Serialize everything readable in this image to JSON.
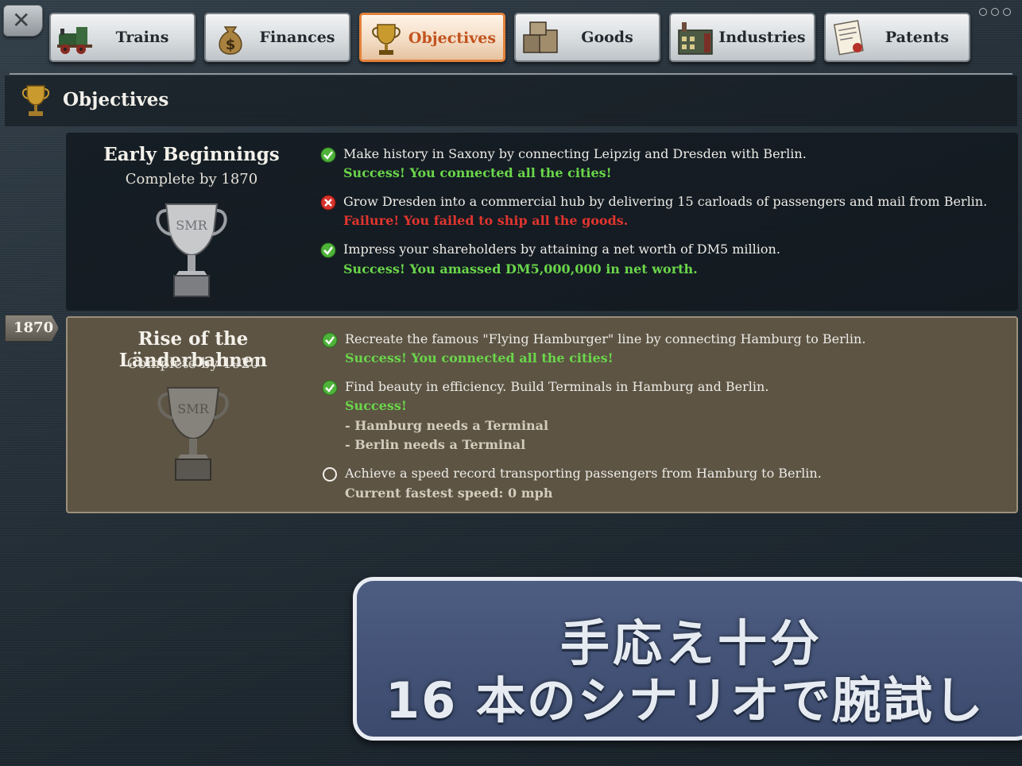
{
  "window": {
    "close_icon": "close-icon"
  },
  "tabs": [
    {
      "label": "Trains",
      "icon": "locomotive-icon",
      "active": false
    },
    {
      "label": "Finances",
      "icon": "money-bag-icon",
      "active": false
    },
    {
      "label": "Objectives",
      "icon": "trophy-icon",
      "active": true
    },
    {
      "label": "Goods",
      "icon": "crates-icon",
      "active": false
    },
    {
      "label": "Industries",
      "icon": "factory-icon",
      "active": false
    },
    {
      "label": "Patents",
      "icon": "patent-document-icon",
      "active": false
    }
  ],
  "header": {
    "title": "Objectives",
    "icon": "trophy-icon"
  },
  "scenarios": [
    {
      "title": "Early Beginnings",
      "deadline": "Complete by 1870",
      "objectives": [
        {
          "status": "success",
          "text": "Make history in Saxony by connecting Leipzig and Dresden with Berlin.",
          "result": "Success! You connected all the cities!"
        },
        {
          "status": "failure",
          "text": "Grow Dresden into a commercial hub by delivering 15 carloads of passengers and mail from Berlin.",
          "result": "Failure! You failed to ship all the goods."
        },
        {
          "status": "success",
          "text": "Impress your shareholders by attaining a net worth of DM5 million.",
          "result": "Success! You amassed DM5,000,000 in net worth."
        }
      ]
    },
    {
      "year_marker": "1870",
      "title": "Rise of the Länderbahnen",
      "deadline": "Complete by 1920",
      "objectives": [
        {
          "status": "success",
          "text": "Recreate the famous \"Flying Hamburger\" line by connecting Hamburg to Berlin.",
          "result": "Success! You connected all the cities!"
        },
        {
          "status": "success",
          "text": "Find beauty in efficiency. Build Terminals in Hamburg and Berlin.",
          "result": "Success!",
          "notes": [
            "- Hamburg needs a Terminal",
            "- Berlin needs a Terminal"
          ]
        },
        {
          "status": "pending",
          "text": "Achieve a speed record transporting passengers from Hamburg to Berlin.",
          "notes": [
            "Current fastest speed: 0 mph"
          ]
        }
      ]
    }
  ],
  "promo": {
    "line1": "手応え十分",
    "line2": "16 本のシナリオで腕試し"
  },
  "colors": {
    "success": "#6ad64a",
    "failure": "#e0352e",
    "active_tab": "#e3813b",
    "panel_highlight": "#5d5444"
  }
}
